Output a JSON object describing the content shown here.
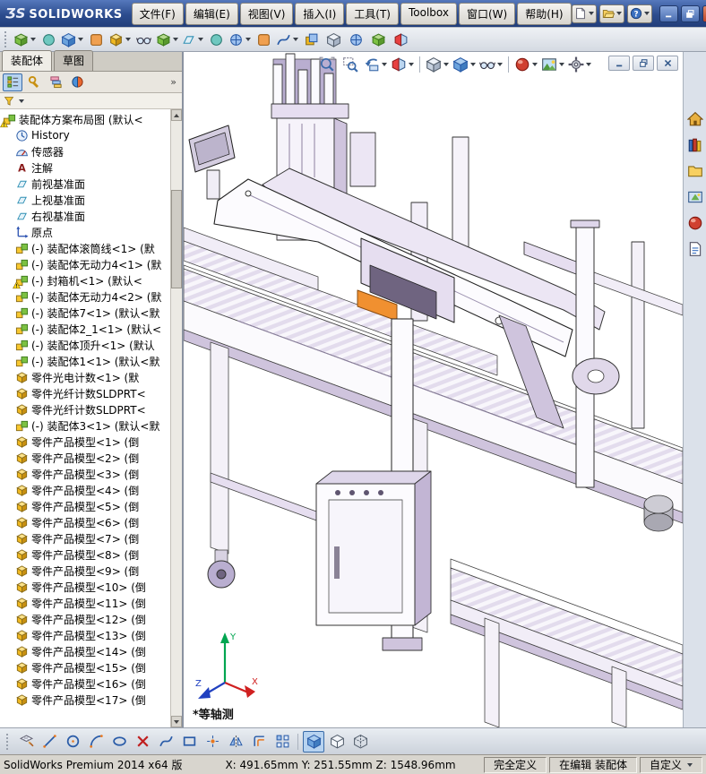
{
  "titlebar": {
    "logo_glyph": "ƷS",
    "logo_text": "SOLIDWORKS",
    "menus": [
      "文件(F)",
      "编辑(E)",
      "视图(V)",
      "插入(I)",
      "工具(T)",
      "Toolbox",
      "窗口(W)",
      "帮助(H)"
    ],
    "quick_buttons": [
      {
        "name": "new-document-button",
        "icon": "page",
        "dropdown": true
      },
      {
        "name": "open-document-button",
        "icon": "open",
        "dropdown": true
      },
      {
        "name": "help-button",
        "icon": "help",
        "dropdown": true
      }
    ],
    "window_buttons": [
      {
        "name": "window-minimize-button",
        "icon": "min"
      },
      {
        "name": "window-restore-button",
        "icon": "max"
      },
      {
        "name": "window-close-button",
        "icon": "close",
        "close": true
      }
    ]
  },
  "main_toolbar": {
    "buttons": [
      {
        "name": "insert-components-button",
        "icon": "gen1",
        "dropdown": true
      },
      {
        "name": "mate-button",
        "icon": "gen4"
      },
      {
        "name": "linear-component-pattern-button",
        "icon": "shadecube",
        "dropdown": true
      },
      {
        "name": "smart-fasteners-button",
        "icon": "gen5"
      },
      {
        "name": "move-component-button",
        "icon": "part",
        "dropdown": true
      },
      {
        "name": "show-hidden-components-button",
        "icon": "glasses"
      },
      {
        "name": "assembly-features-button",
        "icon": "gen1",
        "dropdown": true
      },
      {
        "name": "reference-geometry-button",
        "icon": "plane",
        "dropdown": true
      },
      {
        "name": "new-motion-study-button",
        "icon": "gen4"
      },
      {
        "name": "bill-of-materials-button",
        "icon": "gen3",
        "dropdown": true
      },
      {
        "name": "exploded-view-button",
        "icon": "gen5"
      },
      {
        "name": "explode-line-sketch-button",
        "icon": "spline",
        "dropdown": true
      },
      {
        "name": "interference-detection-button",
        "icon": "gen2"
      },
      {
        "name": "clearance-verification-button",
        "icon": "cube"
      },
      {
        "name": "measure-button",
        "icon": "gen3"
      },
      {
        "name": "mass-properties-button",
        "icon": "gen1"
      },
      {
        "name": "section-properties-button",
        "icon": "section"
      }
    ]
  },
  "left_panel": {
    "tabs": [
      {
        "label": "装配体",
        "active": true
      },
      {
        "label": "草图",
        "active": false
      }
    ],
    "manager_tabs": [
      {
        "name": "featuremanager-tree-tab",
        "icon": "tree",
        "active": true
      },
      {
        "name": "propertymanager-tab",
        "icon": "prop"
      },
      {
        "name": "configurationmanager-tab",
        "icon": "config"
      },
      {
        "name": "displaymanager-tab",
        "icon": "display"
      }
    ],
    "overflow_glyph": "»",
    "tree": [
      {
        "icon": "asm",
        "warning": true,
        "label": "装配体方案布局图 (默认<"
      },
      {
        "icon": "clock",
        "label": "History"
      },
      {
        "icon": "sensor",
        "label": "传感器"
      },
      {
        "icon": "annA",
        "label": "注解"
      },
      {
        "icon": "plane",
        "label": "前视基准面"
      },
      {
        "icon": "plane",
        "label": "上视基准面"
      },
      {
        "icon": "plane",
        "label": "右视基准面"
      },
      {
        "icon": "origin",
        "label": "原点"
      },
      {
        "icon": "asm",
        "label": "(-) 装配体滚筒线<1> (默"
      },
      {
        "icon": "asm",
        "label": "(-) 装配体无动力4<1> (默"
      },
      {
        "icon": "asm",
        "warning": true,
        "label": "(-) 封箱机<1> (默认<"
      },
      {
        "icon": "asm",
        "label": "(-) 装配体无动力4<2> (默"
      },
      {
        "icon": "asm",
        "label": "(-) 装配体7<1> (默认<默"
      },
      {
        "icon": "asm",
        "label": "(-) 装配体2_1<1> (默认<"
      },
      {
        "icon": "asm",
        "label": "(-) 装配体顶升<1> (默认"
      },
      {
        "icon": "asm",
        "label": "(-) 装配体1<1> (默认<默"
      },
      {
        "icon": "part",
        "label": "零件光电计数<1> (默"
      },
      {
        "icon": "part",
        "label": "零件光纤计数SLDPRT<"
      },
      {
        "icon": "part",
        "label": "零件光纤计数SLDPRT<"
      },
      {
        "icon": "asm",
        "label": "(-) 装配体3<1> (默认<默"
      },
      {
        "icon": "part",
        "label": "零件产品模型<1> (倒"
      },
      {
        "icon": "part",
        "label": "零件产品模型<2> (倒"
      },
      {
        "icon": "part",
        "label": "零件产品模型<3> (倒"
      },
      {
        "icon": "part",
        "label": "零件产品模型<4> (倒"
      },
      {
        "icon": "part",
        "label": "零件产品模型<5> (倒"
      },
      {
        "icon": "part",
        "label": "零件产品模型<6> (倒"
      },
      {
        "icon": "part",
        "label": "零件产品模型<7> (倒"
      },
      {
        "icon": "part",
        "label": "零件产品模型<8> (倒"
      },
      {
        "icon": "part",
        "label": "零件产品模型<9> (倒"
      },
      {
        "icon": "part",
        "label": "零件产品模型<10> (倒"
      },
      {
        "icon": "part",
        "label": "零件产品模型<11> (倒"
      },
      {
        "icon": "part",
        "label": "零件产品模型<12> (倒"
      },
      {
        "icon": "part",
        "label": "零件产品模型<13> (倒"
      },
      {
        "icon": "part",
        "label": "零件产品模型<14> (倒"
      },
      {
        "icon": "part",
        "label": "零件产品模型<15> (倒"
      },
      {
        "icon": "part",
        "label": "零件产品模型<16> (倒"
      },
      {
        "icon": "part",
        "label": "零件产品模型<17> (倒"
      }
    ]
  },
  "viewport": {
    "hud_buttons": [
      {
        "name": "zoom-to-fit-button",
        "icon": "zoomfit"
      },
      {
        "name": "zoom-to-area-button",
        "icon": "zoomarea"
      },
      {
        "name": "previous-view-button",
        "icon": "prev",
        "dropdown": true
      },
      {
        "name": "section-view-button",
        "icon": "section",
        "dropdown": true
      },
      {
        "sep": true
      },
      {
        "name": "view-orientation-button",
        "icon": "cube",
        "dropdown": true
      },
      {
        "name": "display-style-button",
        "icon": "shadecube",
        "dropdown": true
      },
      {
        "name": "hide-show-items-button",
        "icon": "glasses",
        "dropdown": true
      },
      {
        "sep": true
      },
      {
        "name": "edit-appearance-button",
        "icon": "ball",
        "dropdown": true
      },
      {
        "name": "apply-scene-button",
        "icon": "scene",
        "dropdown": true
      },
      {
        "name": "view-settings-button",
        "icon": "gear",
        "dropdown": true
      }
    ],
    "doc_window_buttons": [
      {
        "name": "doc-minimize-button",
        "icon": "min"
      },
      {
        "name": "doc-restore-button",
        "icon": "max"
      },
      {
        "name": "doc-close-button",
        "icon": "close"
      }
    ],
    "orientation_label": "*等轴测",
    "triad": {
      "x": "X",
      "y": "Y",
      "z": "Z"
    },
    "model_colors": {
      "outline": "#2a2a30",
      "face_white": "#fcfbfe",
      "shade_light": "#e6def0",
      "shade_mid": "#cfc4dd",
      "shade_dark": "#b9aed0",
      "accent_orange": "#f09030"
    }
  },
  "task_pane": {
    "buttons": [
      {
        "name": "solidworks-resources-button",
        "icon": "house"
      },
      {
        "name": "design-library-button",
        "icon": "books"
      },
      {
        "name": "file-explorer-button",
        "icon": "folder"
      },
      {
        "name": "view-palette-button",
        "icon": "palette"
      },
      {
        "name": "appearances-scenes-button",
        "icon": "ball"
      },
      {
        "name": "custom-properties-button",
        "icon": "props"
      }
    ]
  },
  "bottom_toolbar": {
    "buttons": [
      {
        "name": "sketch-button",
        "icon": "grid"
      },
      {
        "name": "line-tool-button",
        "icon": "line"
      },
      {
        "name": "circle-tool-button",
        "icon": "circle2"
      },
      {
        "name": "arc-tool-button",
        "icon": "arc"
      },
      {
        "name": "ellipse-tool-button",
        "icon": "ellipse2"
      },
      {
        "name": "trim-entities-button",
        "icon": "x"
      },
      {
        "name": "spline-tool-button",
        "icon": "spline"
      },
      {
        "name": "rectangle-tool-button",
        "icon": "rect2"
      },
      {
        "name": "point-tool-button",
        "icon": "point"
      },
      {
        "name": "mirror-entities-button",
        "icon": "mirror"
      },
      {
        "name": "offset-entities-button",
        "icon": "offset"
      },
      {
        "name": "linear-sketch-pattern-button",
        "icon": "pattern"
      },
      {
        "sep": true
      },
      {
        "name": "shaded-with-edges-button",
        "icon": "shadecube",
        "active": true
      },
      {
        "name": "hidden-lines-visible-button",
        "icon": "hlr"
      },
      {
        "name": "wireframe-button",
        "icon": "wire"
      }
    ]
  },
  "statusbar": {
    "app_version": "SolidWorks Premium 2014 x64 版",
    "coordinates": "X: 491.65mm Y: 251.55mm Z: 1548.96mm",
    "define_status": "完全定义",
    "edit_status": "在编辑 装配体",
    "custom_label": "自定义"
  }
}
